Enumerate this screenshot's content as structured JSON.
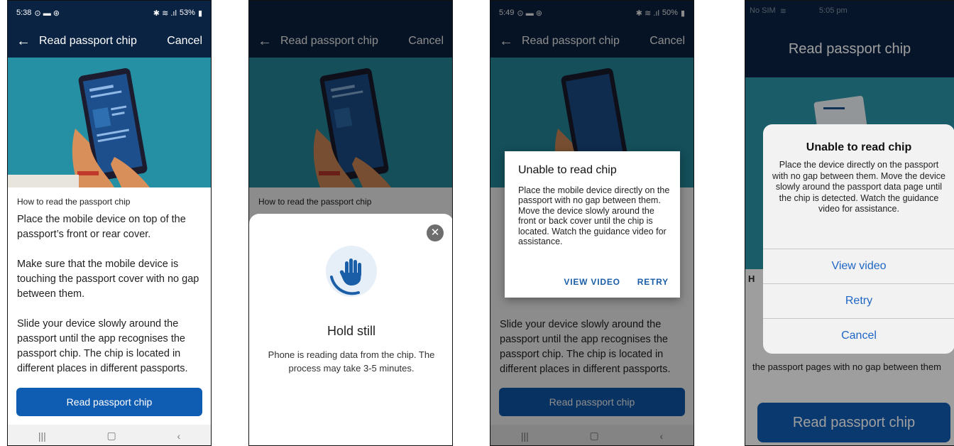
{
  "screen1": {
    "status": {
      "time": "5:38",
      "battery": "53%"
    },
    "header": {
      "back_icon": "arrow-left-icon",
      "title": "Read passport chip",
      "cancel": "Cancel"
    },
    "content": {
      "heading": "How to read the passport chip",
      "paragraphs": [
        "Place the mobile device on top of the passport’s front or rear cover.",
        "Make sure that the mobile device is touching the passport cover with no gap between them.",
        "Slide your device slowly around the passport until the app recognises the passport chip. The chip is located in different places in different passports."
      ]
    },
    "button": "Read passport chip"
  },
  "screen2": {
    "header": {
      "title": "Read passport chip",
      "cancel": "Cancel"
    },
    "content_heading": "How to read the passport chip",
    "sheet": {
      "close_icon": "close-circle-icon",
      "icon": "hand-icon",
      "title": "Hold still",
      "message": "Phone is reading data from the chip. The process may take 3-5 minutes."
    }
  },
  "screen3": {
    "status": {
      "time": "5:49",
      "battery": "50%"
    },
    "header": {
      "title": "Read passport chip",
      "cancel": "Cancel"
    },
    "background_text": "Slide your device slowly around the passport until the app recognises the passport chip. The chip is located in different places in different passports.",
    "dialog": {
      "title": "Unable to read chip",
      "message": "Place the mobile device directly on the passport with no gap between them. Move the device slowly around the front or back cover until the chip is located. Watch the guidance video for assistance.",
      "view_video": "VIEW VIDEO",
      "retry": "RETRY"
    },
    "button": "Read passport chip"
  },
  "screen4": {
    "status": {
      "carrier": "No SIM",
      "time": "5:05 pm"
    },
    "header": {
      "title": "Read passport chip"
    },
    "background_text": "the passport pages with no gap between them",
    "alert": {
      "title": "Unable to read chip",
      "message": "Place the device directly on the passport with no gap between them. Move the device slowly around the passport data page until the chip is detected. Watch the guidance video for assistance.",
      "view_video": "View video",
      "retry": "Retry",
      "cancel": "Cancel"
    },
    "button": "Read passport chip"
  },
  "colors": {
    "navy": "#0b2343",
    "teal": "#2590a4",
    "primary": "#0f5cb3",
    "link": "#1a5ea8"
  }
}
